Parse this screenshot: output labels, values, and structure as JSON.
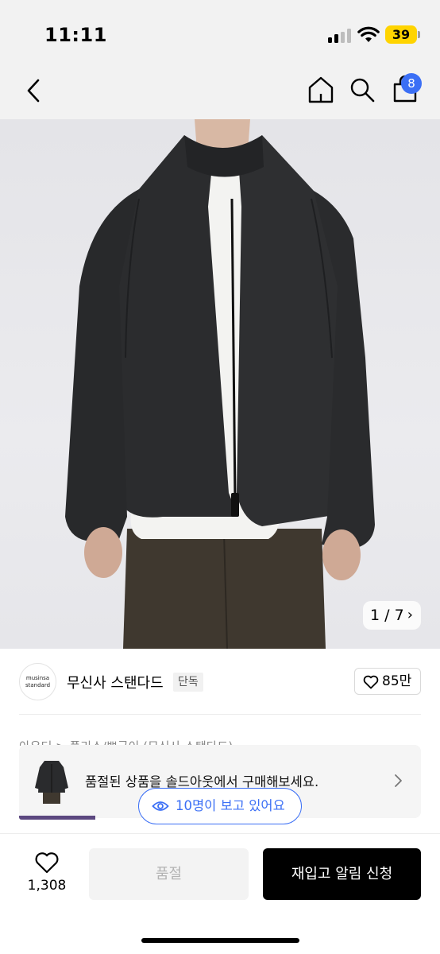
{
  "status_bar": {
    "time": "11:11",
    "battery": "39",
    "icons": [
      "cellular-signal-icon",
      "wifi-icon",
      "battery-icon"
    ]
  },
  "nav": {
    "icons": [
      "back-chevron-icon",
      "home-icon",
      "search-icon",
      "shopping-bag-icon"
    ],
    "cart_count": "8"
  },
  "product_image": {
    "description_icon": "product-photo",
    "counter": "1 / 7"
  },
  "brand": {
    "logo_line1": "musinsa",
    "logo_line2": "standard",
    "name": "무신사 스탠다드",
    "badge": "단독",
    "likes": "85만"
  },
  "breadcrumb": "아우터 > 플리스/뽀글이 (무신사 스탠다드)",
  "soldout_banner": {
    "text": "품절된 상품을 솔드아웃에서 구매해보세요."
  },
  "viewers": {
    "text": "10명이 보고 있어요"
  },
  "bottom_bar": {
    "wish_count": "1,308",
    "soldout_label": "품절",
    "restock_label": "재입고 알림 신청"
  },
  "colors": {
    "accent_blue": "#3b6ff5",
    "black": "#000000",
    "battery_yellow": "#ffd400"
  }
}
